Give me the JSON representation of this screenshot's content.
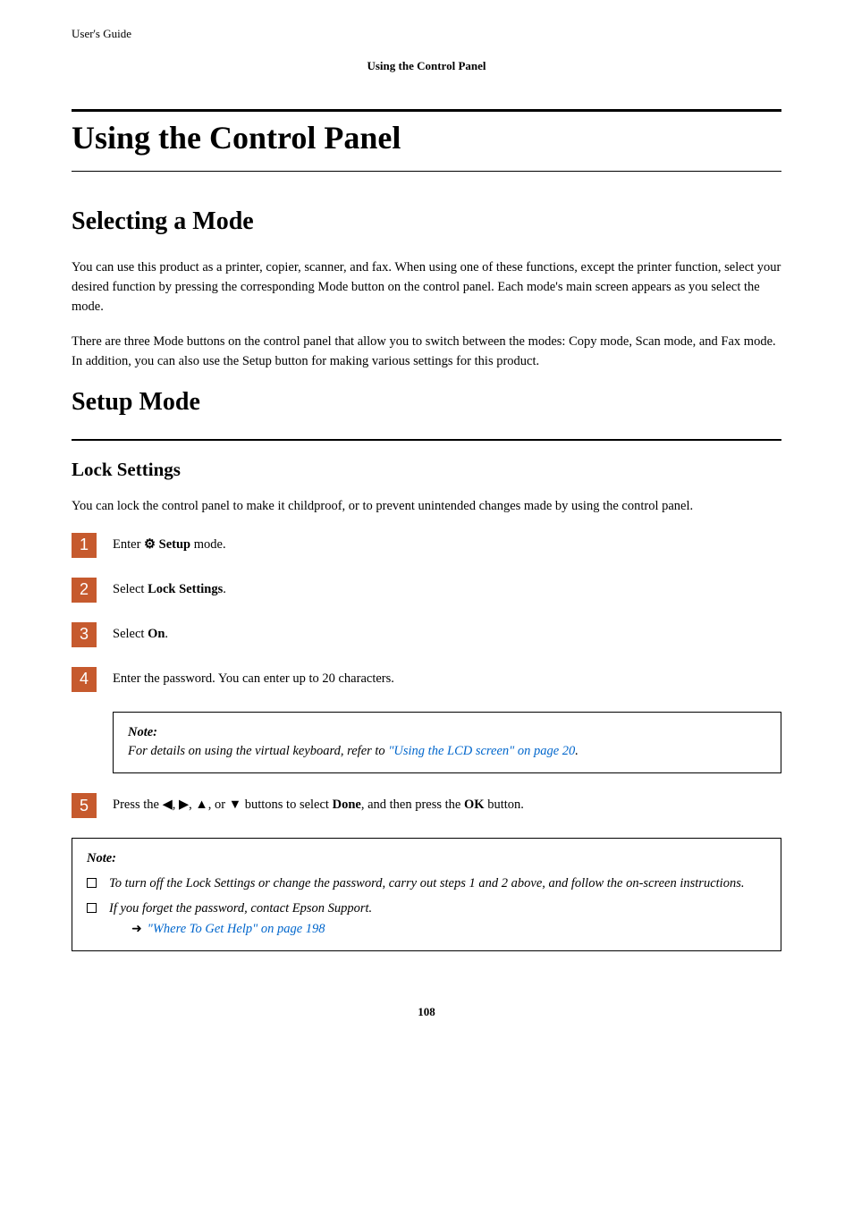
{
  "header": {
    "guide": "User's Guide",
    "breadcrumb": "Using the Control Panel"
  },
  "h1": "Using the Control Panel",
  "section1": {
    "title": "Selecting a Mode",
    "p1": "You can use this product as a printer, copier, scanner, and fax. When using one of these functions, except the printer function, select your desired function by pressing the corresponding Mode button on the control panel. Each mode's main screen appears as you select the mode.",
    "p2": "There are three Mode buttons on the control panel that allow you to switch between the modes: Copy mode, Scan mode, and Fax mode. In addition, you can also use the Setup button for making various settings for this product."
  },
  "section2": {
    "title": "Setup Mode",
    "sub1": {
      "title": "Lock Settings",
      "intro": "You can lock the control panel to make it childproof, or to prevent unintended changes made by using the control panel.",
      "steps": {
        "s1_pre": "Enter ",
        "s1_bold": "Setup",
        "s1_post": " mode.",
        "s2_pre": "Select ",
        "s2_bold": "Lock Settings",
        "s2_post": ".",
        "s3_pre": "Select ",
        "s3_bold": "On",
        "s3_post": ".",
        "s4": "Enter the password. You can enter up to 20 characters.",
        "s5_pre": "Press the ",
        "s5_mid": " buttons to select ",
        "s5_done": "Done",
        "s5_mid2": ", and then press the ",
        "s5_ok": "OK",
        "s5_post": " button."
      },
      "note1": {
        "label": "Note:",
        "text": "For details on using the virtual keyboard, refer to ",
        "link": "\"Using the LCD screen\" on page 20",
        "post": "."
      },
      "note2": {
        "label": "Note:",
        "b1": "To turn off the Lock Settings or change the password, carry out steps 1 and 2 above, and follow the on-screen instructions.",
        "b2": "If you forget the password, contact Epson Support.",
        "b2link": "\"Where To Get Help\" on page 198"
      }
    }
  },
  "pagenum": "108"
}
